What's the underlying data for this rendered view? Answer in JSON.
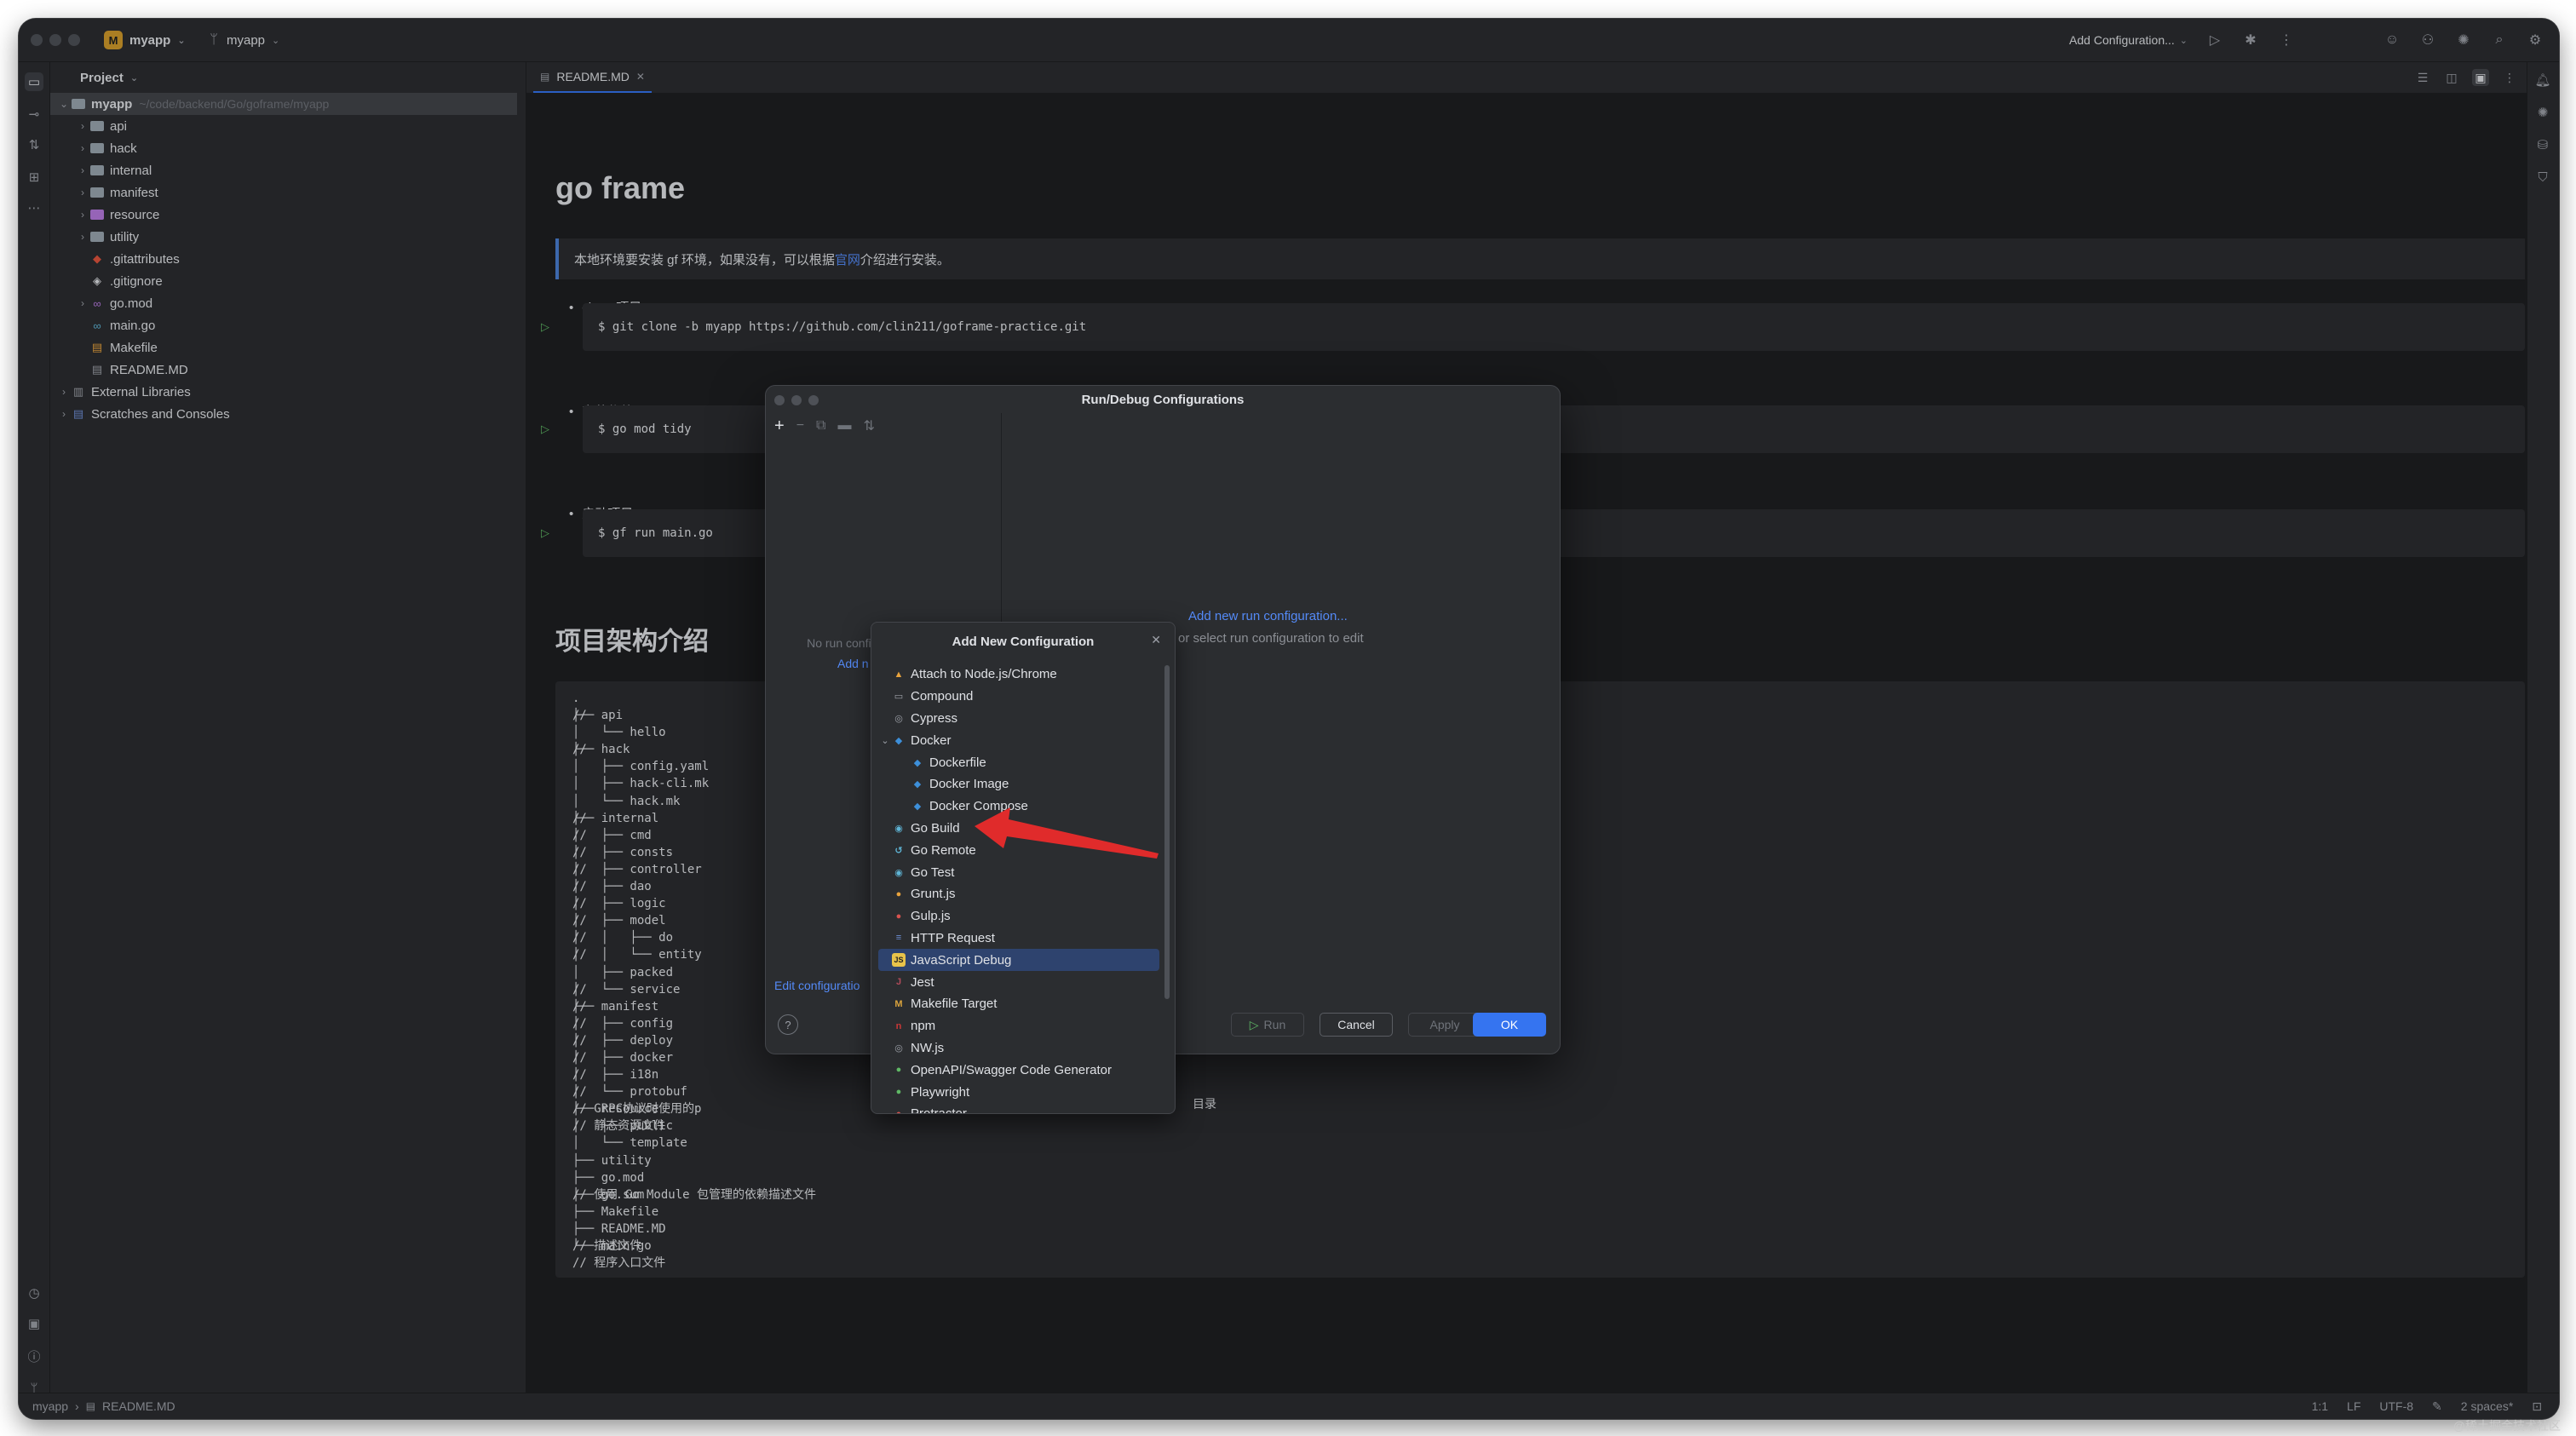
{
  "titlebar": {
    "project_badge": "M",
    "project_name": "myapp",
    "branch_name": "myapp",
    "run_config": "Add Configuration..."
  },
  "project_panel": {
    "title": "Project",
    "tree": [
      {
        "label": "myapp",
        "path": "~/code/backend/Go/goframe/myapp",
        "depth": 0,
        "expanded": true,
        "icon": "folder-icon"
      },
      {
        "label": "api",
        "depth": 1,
        "icon": "folder-icon"
      },
      {
        "label": "hack",
        "depth": 1,
        "icon": "folder-icon"
      },
      {
        "label": "internal",
        "depth": 1,
        "icon": "folder-icon"
      },
      {
        "label": "manifest",
        "depth": 1,
        "icon": "folder-icon"
      },
      {
        "label": "resource",
        "depth": 1,
        "icon": "resource-folder-icon"
      },
      {
        "label": "utility",
        "depth": 1,
        "icon": "folder-icon"
      },
      {
        "label": ".gitattributes",
        "depth": 1,
        "icon": "git-icon"
      },
      {
        "label": ".gitignore",
        "depth": 1,
        "icon": "gitignore-icon"
      },
      {
        "label": "go.mod",
        "depth": 1,
        "icon": "go-mod-icon"
      },
      {
        "label": "main.go",
        "depth": 1,
        "icon": "go-file-icon"
      },
      {
        "label": "Makefile",
        "depth": 1,
        "icon": "makefile-icon"
      },
      {
        "label": "README.MD",
        "depth": 1,
        "icon": "markdown-file-icon"
      },
      {
        "label": "External Libraries",
        "depth": 0,
        "icon": "library-icon"
      },
      {
        "label": "Scratches and Consoles",
        "depth": 0,
        "icon": "scratches-icon"
      }
    ]
  },
  "editor": {
    "tab_label": "README.MD",
    "h1": "go frame",
    "quote_before": "本地环境要安装 gf 环境，如果没有，可以根据",
    "quote_link": "官网",
    "quote_after": "介绍进行安装。",
    "bullets": [
      "clone 项目",
      "安装依赖",
      "启动项目"
    ],
    "code": [
      "$ git clone -b myapp https://github.com/clin211/goframe-practice.git",
      "$ go mod tidy",
      "$ gf run main.go"
    ],
    "h2": "项目架构介绍",
    "tree_text": ".\n├── api\n│   └── hello\n├── hack\n│   ├── config.yaml\n│   ├── hack-cli.mk\n│   └── hack.mk\n├── internal\n│   ├── cmd\n│   ├── consts\n│   ├── controller\n│   ├── dao\n│   ├── logic\n│   ├── model\n│   │   ├── do\n│   │   └── entity\n│   ├── packed\n│   └── service\n├── manifest\n│   ├── config\n│   ├── deploy\n│   ├── docker\n│   ├── i18n\n│   └── protobuf\n├── resource\n│   ├── public\n│   └── template\n├── utility\n├── go.mod\n├── go.sum\n├── Makefile\n├── README.MD\n└── main.go",
    "tree_comments": "\n//\n\n//\n\n\n\n//\n//\n//\n//\n//\n//\n//\n//\n//\n\n//\n//\n//\n//\n//\n//\n//\n// GRPC协议时使用的p\n// 静态资源文件\n\n\n\n// 使用 Go Module 包管理的依赖描述文件\n\n\n// 描述文件\n// 程序入口文件",
    "hidden_comment_tail": "目录"
  },
  "run_debug_dialog": {
    "title": "Run/Debug Configurations",
    "empty_text": "No run configurations added.",
    "add_link_partial": "Add n",
    "edit_link_partial": "Edit configuratio",
    "right_link": "Add new run configuration...",
    "right_sub": "or select run configuration to edit",
    "buttons": {
      "run": "Run",
      "cancel": "Cancel",
      "apply": "Apply",
      "ok": "OK",
      "help": "?"
    }
  },
  "add_new_config": {
    "title": "Add New Configuration",
    "items": [
      {
        "label": "Attach to Node.js/Chrome",
        "icon": "nodejs-attach-icon",
        "indent": 0,
        "color": "#e8a33d",
        "glyph": "▲"
      },
      {
        "label": "Compound",
        "icon": "compound-icon",
        "indent": 0,
        "color": "#9da0a8",
        "glyph": "▭"
      },
      {
        "label": "Cypress",
        "icon": "cypress-icon",
        "indent": 0,
        "color": "#9da0a8",
        "glyph": "◎"
      },
      {
        "label": "Docker",
        "icon": "docker-icon",
        "indent": 0,
        "expanded": true,
        "color": "#3d8fd9",
        "glyph": "◆"
      },
      {
        "label": "Dockerfile",
        "icon": "docker-icon",
        "indent": 1,
        "color": "#3d8fd9",
        "glyph": "◆"
      },
      {
        "label": "Docker Image",
        "icon": "docker-icon",
        "indent": 1,
        "color": "#3d8fd9",
        "glyph": "◆"
      },
      {
        "label": "Docker Compose",
        "icon": "docker-icon",
        "indent": 1,
        "color": "#3d8fd9",
        "glyph": "◆"
      },
      {
        "label": "Go Build",
        "icon": "go-build-icon",
        "indent": 0,
        "color": "#5fb5d6",
        "glyph": "◉"
      },
      {
        "label": "Go Remote",
        "icon": "go-remote-icon",
        "indent": 0,
        "color": "#5fb5d6",
        "glyph": "↺"
      },
      {
        "label": "Go Test",
        "icon": "go-test-icon",
        "indent": 0,
        "color": "#5fb5d6",
        "glyph": "◉"
      },
      {
        "label": "Grunt.js",
        "icon": "grunt-icon",
        "indent": 0,
        "color": "#e8a33d",
        "glyph": "●"
      },
      {
        "label": "Gulp.js",
        "icon": "gulp-icon",
        "indent": 0,
        "color": "#d9534f",
        "glyph": "●"
      },
      {
        "label": "HTTP Request",
        "icon": "http-request-icon",
        "indent": 0,
        "color": "#6f8fd6",
        "glyph": "≡"
      },
      {
        "label": "JavaScript Debug",
        "icon": "javascript-debug-icon",
        "indent": 0,
        "selected": true,
        "color": "#e8c34a",
        "glyph": "JS"
      },
      {
        "label": "Jest",
        "icon": "jest-icon",
        "indent": 0,
        "color": "#b04a5a",
        "glyph": "J"
      },
      {
        "label": "Makefile Target",
        "icon": "makefile-icon",
        "indent": 0,
        "color": "#d9a33d",
        "glyph": "M"
      },
      {
        "label": "npm",
        "icon": "npm-icon",
        "indent": 0,
        "color": "#cb3837",
        "glyph": "n"
      },
      {
        "label": "NW.js",
        "icon": "nwjs-icon",
        "indent": 0,
        "color": "#9da0a8",
        "glyph": "◎"
      },
      {
        "label": "OpenAPI/Swagger Code Generator",
        "icon": "openapi-icon",
        "indent": 0,
        "color": "#5fb865",
        "glyph": "●"
      },
      {
        "label": "Playwright",
        "icon": "playwright-icon",
        "indent": 0,
        "color": "#5fb865",
        "glyph": "●"
      },
      {
        "label": "Protractor",
        "icon": "protractor-icon",
        "indent": 0,
        "color": "#d9534f",
        "glyph": "●"
      }
    ]
  },
  "statusbar": {
    "crumb_project": "myapp",
    "crumb_file": "README.MD",
    "position": "1:1",
    "line_sep": "LF",
    "encoding": "UTF-8",
    "indent": "2 spaces*"
  },
  "watermark": "@稀土掘金技术社区",
  "colors": {
    "accent": "#3574f0",
    "link": "#548af7",
    "annotation_arrow": "#e02b2b"
  }
}
